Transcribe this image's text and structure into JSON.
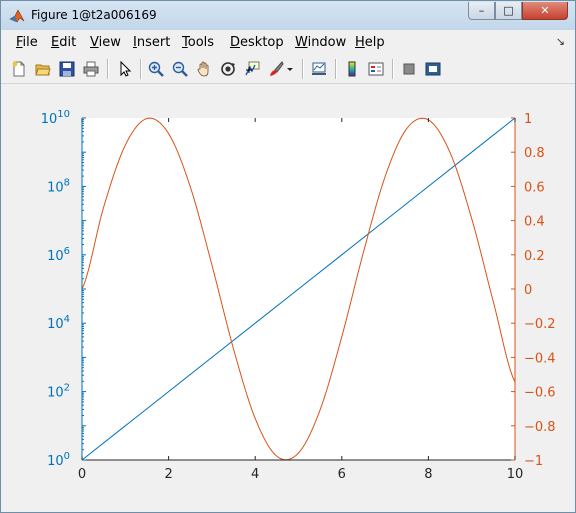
{
  "window": {
    "title": "Figure 1@t2a006169",
    "minimize_glyph": "–",
    "maximize_glyph": "□",
    "close_glyph": "✕"
  },
  "menubar": {
    "items": [
      {
        "label": "File",
        "mnemonic": "F",
        "rest": "ile"
      },
      {
        "label": "Edit",
        "mnemonic": "E",
        "rest": "dit"
      },
      {
        "label": "View",
        "mnemonic": "V",
        "rest": "iew"
      },
      {
        "label": "Insert",
        "mnemonic": "I",
        "rest": "nsert"
      },
      {
        "label": "Tools",
        "mnemonic": "T",
        "rest": "ools"
      },
      {
        "label": "Desktop",
        "mnemonic": "D",
        "rest": "esktop"
      },
      {
        "label": "Window",
        "mnemonic": "W",
        "rest": "indow"
      },
      {
        "label": "Help",
        "mnemonic": "H",
        "rest": "elp"
      }
    ],
    "dock_arrow": "↘"
  },
  "toolbar": {
    "icons": [
      "new-figure-icon",
      "open-file-icon",
      "save-icon",
      "print-icon",
      "edit-plot-arrow-icon",
      "zoom-in-icon",
      "zoom-out-icon",
      "pan-hand-icon",
      "rotate-3d-icon",
      "data-cursor-icon",
      "brush-icon",
      "link-plot-icon",
      "insert-colorbar-icon",
      "insert-legend-icon",
      "hide-plot-tools-icon",
      "show-plot-tools-icon"
    ]
  },
  "colors": {
    "left_axis": "#0072bd",
    "right_axis": "#d95319",
    "plot_bg": "#ffffff",
    "figure_bg": "#f0f0f0"
  },
  "chart_data": {
    "type": "line",
    "x_range": [
      0,
      10
    ],
    "x_ticks": [
      "0",
      "2",
      "4",
      "6",
      "8",
      "10"
    ],
    "left_axis": {
      "scale": "log",
      "range": [
        1,
        10000000000
      ],
      "tick_base": "10",
      "tick_exponents": [
        "0",
        "2",
        "4",
        "6",
        "8",
        "10"
      ],
      "color": "#0072bd"
    },
    "right_axis": {
      "scale": "linear",
      "range": [
        -1,
        1
      ],
      "ticks": [
        "−1",
        "−0.8",
        "−0.6",
        "−0.4",
        "−0.2",
        "0",
        "0.2",
        "0.4",
        "0.6",
        "0.8",
        "1"
      ],
      "color": "#d95319"
    },
    "series": [
      {
        "axis": "left",
        "color": "#0072bd",
        "x": [
          0,
          1,
          2,
          3,
          4,
          5,
          6,
          7,
          8,
          9,
          10
        ],
        "y": [
          1,
          10,
          100,
          1000,
          10000,
          100000,
          1000000,
          10000000,
          100000000,
          1000000000,
          10000000000
        ]
      },
      {
        "axis": "right",
        "color": "#d95319",
        "x": [
          0,
          0.5,
          1,
          1.5,
          2,
          2.5,
          3,
          3.5,
          4,
          4.5,
          5,
          5.5,
          6,
          6.5,
          7,
          7.5,
          8,
          8.5,
          9,
          9.5,
          10
        ],
        "y": [
          0,
          0.479,
          0.841,
          0.997,
          0.909,
          0.598,
          0.141,
          -0.351,
          -0.757,
          -0.978,
          -0.959,
          -0.706,
          -0.279,
          0.215,
          0.657,
          0.938,
          0.989,
          0.798,
          0.412,
          -0.075,
          -0.544
        ]
      }
    ],
    "grid": false,
    "legend": "none"
  }
}
